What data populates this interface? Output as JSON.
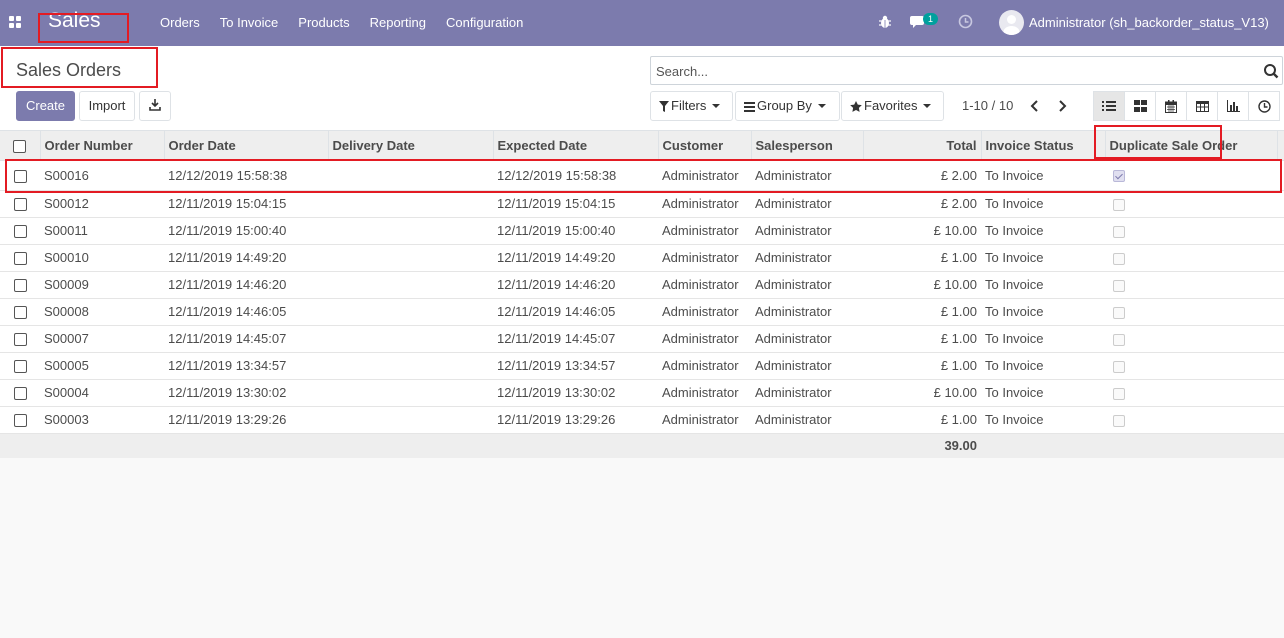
{
  "navbar": {
    "app_name": "Sales",
    "menu": [
      "Orders",
      "To Invoice",
      "Products",
      "Reporting",
      "Configuration"
    ],
    "chat_badge": "1",
    "user": "Administrator (sh_backorder_status_V13)",
    "color": "#7c7bad"
  },
  "control_panel": {
    "title": "Sales Orders",
    "search_placeholder": "Search...",
    "create_label": "Create",
    "import_label": "Import",
    "filters_label": "Filters",
    "groupby_label": "Group By",
    "favorites_label": "Favorites",
    "pager": "1-10 / 10",
    "views": [
      "list-icon",
      "kanban-icon",
      "calendar-icon",
      "pivot-icon",
      "graph-icon",
      "activity-icon"
    ],
    "active_view": "list-icon"
  },
  "table": {
    "headers": [
      "Order Number",
      "Order Date",
      "Delivery Date",
      "Expected Date",
      "Customer",
      "Salesperson",
      "Total",
      "Invoice Status",
      "Duplicate Sale Order"
    ],
    "rows": [
      {
        "number": "S00016",
        "order_date": "12/12/2019 15:58:38",
        "delivery_date": "",
        "expected_date": "12/12/2019 15:58:38",
        "customer": "Administrator",
        "salesperson": "Administrator",
        "total": "£ 2.00",
        "invoice_status": "To Invoice",
        "duplicate": true
      },
      {
        "number": "S00012",
        "order_date": "12/11/2019 15:04:15",
        "delivery_date": "",
        "expected_date": "12/11/2019 15:04:15",
        "customer": "Administrator",
        "salesperson": "Administrator",
        "total": "£ 2.00",
        "invoice_status": "To Invoice",
        "duplicate": false
      },
      {
        "number": "S00011",
        "order_date": "12/11/2019 15:00:40",
        "delivery_date": "",
        "expected_date": "12/11/2019 15:00:40",
        "customer": "Administrator",
        "salesperson": "Administrator",
        "total": "£ 10.00",
        "invoice_status": "To Invoice",
        "duplicate": false
      },
      {
        "number": "S00010",
        "order_date": "12/11/2019 14:49:20",
        "delivery_date": "",
        "expected_date": "12/11/2019 14:49:20",
        "customer": "Administrator",
        "salesperson": "Administrator",
        "total": "£ 1.00",
        "invoice_status": "To Invoice",
        "duplicate": false
      },
      {
        "number": "S00009",
        "order_date": "12/11/2019 14:46:20",
        "delivery_date": "",
        "expected_date": "12/11/2019 14:46:20",
        "customer": "Administrator",
        "salesperson": "Administrator",
        "total": "£ 10.00",
        "invoice_status": "To Invoice",
        "duplicate": false
      },
      {
        "number": "S00008",
        "order_date": "12/11/2019 14:46:05",
        "delivery_date": "",
        "expected_date": "12/11/2019 14:46:05",
        "customer": "Administrator",
        "salesperson": "Administrator",
        "total": "£ 1.00",
        "invoice_status": "To Invoice",
        "duplicate": false
      },
      {
        "number": "S00007",
        "order_date": "12/11/2019 14:45:07",
        "delivery_date": "",
        "expected_date": "12/11/2019 14:45:07",
        "customer": "Administrator",
        "salesperson": "Administrator",
        "total": "£ 1.00",
        "invoice_status": "To Invoice",
        "duplicate": false
      },
      {
        "number": "S00005",
        "order_date": "12/11/2019 13:34:57",
        "delivery_date": "",
        "expected_date": "12/11/2019 13:34:57",
        "customer": "Administrator",
        "salesperson": "Administrator",
        "total": "£ 1.00",
        "invoice_status": "To Invoice",
        "duplicate": false
      },
      {
        "number": "S00004",
        "order_date": "12/11/2019 13:30:02",
        "delivery_date": "",
        "expected_date": "12/11/2019 13:30:02",
        "customer": "Administrator",
        "salesperson": "Administrator",
        "total": "£ 10.00",
        "invoice_status": "To Invoice",
        "duplicate": false
      },
      {
        "number": "S00003",
        "order_date": "12/11/2019 13:29:26",
        "delivery_date": "",
        "expected_date": "12/11/2019 13:29:26",
        "customer": "Administrator",
        "salesperson": "Administrator",
        "total": "£ 1.00",
        "invoice_status": "To Invoice",
        "duplicate": false
      }
    ],
    "sum_total": "39.00"
  }
}
